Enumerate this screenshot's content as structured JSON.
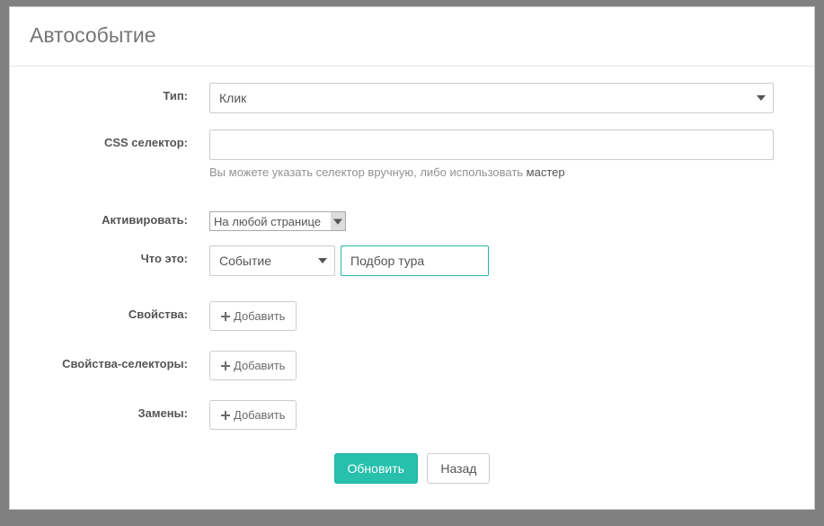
{
  "header": {
    "title": "Автособытие"
  },
  "form": {
    "type": {
      "label": "Тип:",
      "value": "Клик"
    },
    "cssSelector": {
      "label": "CSS селектор:",
      "value": "",
      "help_prefix": "Вы можете указать селектор вручную, либо использовать ",
      "help_link": "мастер"
    },
    "activate": {
      "label": "Активировать:",
      "value": "На любой странице"
    },
    "whatIs": {
      "label": "Что это:",
      "selectValue": "Событие",
      "textValue": "Подбор тура"
    },
    "properties": {
      "label": "Свойства:"
    },
    "propertiesSelectors": {
      "label": "Свойства-селекторы:"
    },
    "replacements": {
      "label": "Замены:"
    }
  },
  "buttons": {
    "add": "Добавить",
    "submit": "Обновить",
    "back": "Назад"
  }
}
